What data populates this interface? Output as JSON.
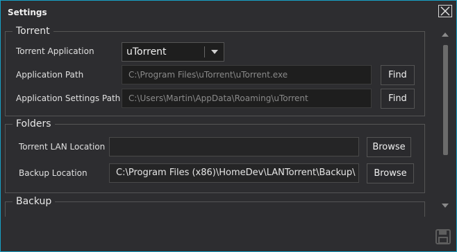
{
  "window": {
    "title": "Settings"
  },
  "torrent": {
    "group_label": "Torrent",
    "app_label": "Torrent Application",
    "app_value": "uTorrent",
    "path_label": "Application Path",
    "path_value": "C:\\Program Files\\uTorrent\\uTorrent.exe",
    "settings_label": "Application Settings Path",
    "settings_value": "C:\\Users\\Martin\\AppData\\Roaming\\uTorrent",
    "find_label": "Find"
  },
  "folders": {
    "group_label": "Folders",
    "lan_label": "Torrent LAN Location",
    "lan_value": "",
    "backup_label": "Backup Location",
    "backup_value": "C:\\Program Files (x86)\\HomeDev\\LANTorrent\\Backup\\",
    "browse_label": "Browse"
  },
  "backup": {
    "group_label": "Backup"
  },
  "icons": {
    "close": "close-icon",
    "dropdown": "chevron-down-icon",
    "scroll_up": "triangle-up-icon",
    "scroll_down": "triangle-down-icon",
    "save": "floppy-disk-icon"
  }
}
